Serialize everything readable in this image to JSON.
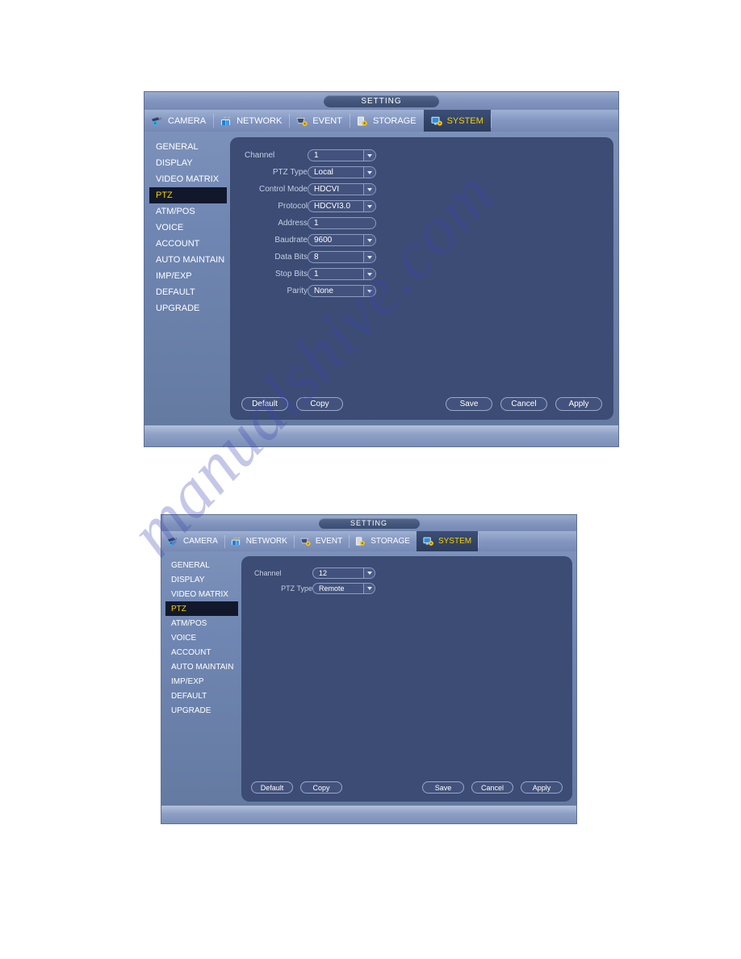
{
  "watermark": {
    "text": "manualshive.com"
  },
  "colors": {
    "accent_yellow": "#f5d000",
    "panel_blue": "#3c4c74",
    "window_blue": "#6f86b2",
    "active_item_dark": "#12182b",
    "label_text": "#c4cee6"
  },
  "dialogs": [
    {
      "id": "dialog-ptz-local",
      "title": "SETTING",
      "tabs": [
        {
          "label": "CAMERA",
          "icon": "camera-icon",
          "active": false
        },
        {
          "label": "NETWORK",
          "icon": "network-icon",
          "active": false
        },
        {
          "label": "EVENT",
          "icon": "event-icon",
          "active": false
        },
        {
          "label": "STORAGE",
          "icon": "storage-icon",
          "active": false
        },
        {
          "label": "SYSTEM",
          "icon": "system-icon",
          "active": true
        }
      ],
      "sidebar": [
        {
          "label": "GENERAL",
          "active": false
        },
        {
          "label": "DISPLAY",
          "active": false
        },
        {
          "label": "VIDEO MATRIX",
          "active": false
        },
        {
          "label": "PTZ",
          "active": true
        },
        {
          "label": "ATM/POS",
          "active": false
        },
        {
          "label": "VOICE",
          "active": false
        },
        {
          "label": "ACCOUNT",
          "active": false
        },
        {
          "label": "AUTO MAINTAIN",
          "active": false
        },
        {
          "label": "IMP/EXP",
          "active": false
        },
        {
          "label": "DEFAULT",
          "active": false
        },
        {
          "label": "UPGRADE",
          "active": false
        }
      ],
      "fields": [
        {
          "label": "Channel",
          "value": "1",
          "type": "dropdown"
        },
        {
          "label": "PTZ Type",
          "value": "Local",
          "type": "dropdown"
        },
        {
          "label": "Control Mode",
          "value": "HDCVI",
          "type": "dropdown"
        },
        {
          "label": "Protocol",
          "value": "HDCVI3.0",
          "type": "dropdown"
        },
        {
          "label": "Address",
          "value": "1",
          "type": "text"
        },
        {
          "label": "Baudrate",
          "value": "9600",
          "type": "dropdown"
        },
        {
          "label": "Data Bits",
          "value": "8",
          "type": "dropdown"
        },
        {
          "label": "Stop Bits",
          "value": "1",
          "type": "dropdown"
        },
        {
          "label": "Parity",
          "value": "None",
          "type": "dropdown"
        }
      ],
      "buttons_left": [
        {
          "label": "Default"
        },
        {
          "label": "Copy"
        }
      ],
      "buttons_right": [
        {
          "label": "Save"
        },
        {
          "label": "Cancel"
        },
        {
          "label": "Apply"
        }
      ]
    },
    {
      "id": "dialog-ptz-remote",
      "title": "SETTING",
      "tabs": [
        {
          "label": "CAMERA",
          "icon": "camera-icon",
          "active": false
        },
        {
          "label": "NETWORK",
          "icon": "network-icon",
          "active": false
        },
        {
          "label": "EVENT",
          "icon": "event-icon",
          "active": false
        },
        {
          "label": "STORAGE",
          "icon": "storage-icon",
          "active": false
        },
        {
          "label": "SYSTEM",
          "icon": "system-icon",
          "active": true
        }
      ],
      "sidebar": [
        {
          "label": "GENERAL",
          "active": false
        },
        {
          "label": "DISPLAY",
          "active": false
        },
        {
          "label": "VIDEO MATRIX",
          "active": false
        },
        {
          "label": "PTZ",
          "active": true
        },
        {
          "label": "ATM/POS",
          "active": false
        },
        {
          "label": "VOICE",
          "active": false
        },
        {
          "label": "ACCOUNT",
          "active": false
        },
        {
          "label": "AUTO MAINTAIN",
          "active": false
        },
        {
          "label": "IMP/EXP",
          "active": false
        },
        {
          "label": "DEFAULT",
          "active": false
        },
        {
          "label": "UPGRADE",
          "active": false
        }
      ],
      "fields": [
        {
          "label": "Channel",
          "value": "12",
          "type": "dropdown"
        },
        {
          "label": "PTZ Type",
          "value": "Remote",
          "type": "dropdown"
        }
      ],
      "buttons_left": [
        {
          "label": "Default"
        },
        {
          "label": "Copy"
        }
      ],
      "buttons_right": [
        {
          "label": "Save"
        },
        {
          "label": "Cancel"
        },
        {
          "label": "Apply"
        }
      ]
    }
  ]
}
